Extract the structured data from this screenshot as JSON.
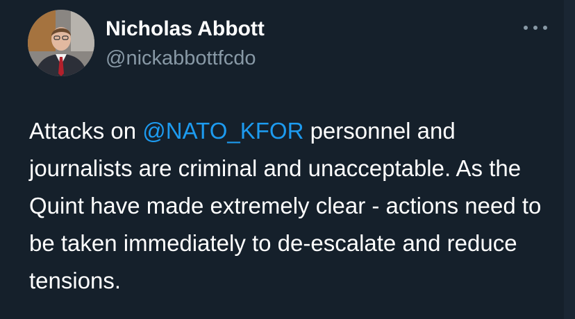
{
  "author": {
    "name": "Nicholas Abbott",
    "handle": "@nickabbottfcdo"
  },
  "tweet": {
    "text_before": "Attacks on ",
    "mention": "@NATO_KFOR",
    "text_after": " personnel and journalists are criminal and unacceptable. As the Quint have made extremely clear - actions need to be taken immediately to de-escalate and reduce tensions."
  },
  "icons": {
    "more": "more-options-icon",
    "avatar": "profile-photo"
  },
  "colors": {
    "background": "#15202b",
    "primary_text": "#ffffff",
    "secondary_text": "#8899a6",
    "link": "#1d9bf0"
  }
}
